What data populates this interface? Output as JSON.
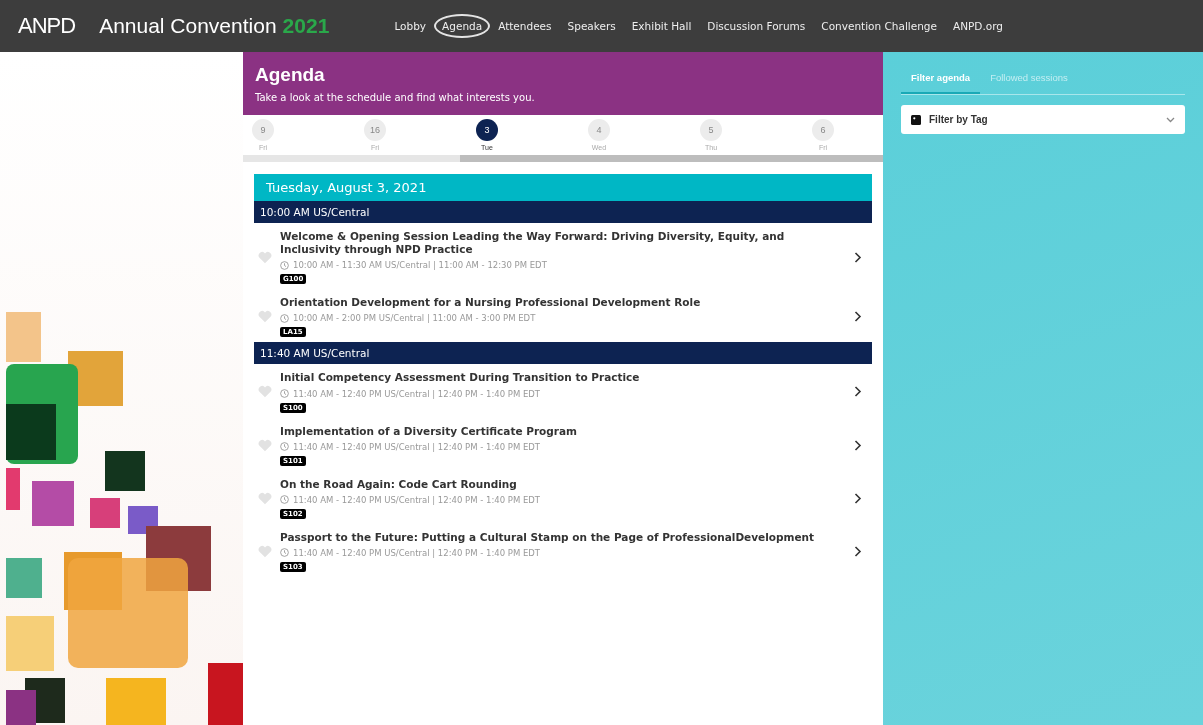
{
  "brand": {
    "logo": "ANPD",
    "title": "Annual Convention",
    "year": "2021"
  },
  "nav": [
    {
      "label": "Lobby",
      "selected": false
    },
    {
      "label": "Agenda",
      "selected": true
    },
    {
      "label": "Attendees",
      "selected": false
    },
    {
      "label": "Speakers",
      "selected": false
    },
    {
      "label": "Exhibit Hall",
      "selected": false
    },
    {
      "label": "Discussion Forums",
      "selected": false
    },
    {
      "label": "Convention Challenge",
      "selected": false
    },
    {
      "label": "ANPD.org",
      "selected": false
    }
  ],
  "header": {
    "title": "Agenda",
    "subtitle": "Take a look at the schedule and find what interests you."
  },
  "days": [
    {
      "number": "9",
      "weekday": "Fri",
      "selected": false
    },
    {
      "number": "16",
      "weekday": "Fri",
      "selected": false
    },
    {
      "number": "3",
      "weekday": "Tue",
      "selected": true
    },
    {
      "number": "4",
      "weekday": "Wed",
      "selected": false
    },
    {
      "number": "5",
      "weekday": "Thu",
      "selected": false
    },
    {
      "number": "6",
      "weekday": "Fri",
      "selected": false
    }
  ],
  "date_heading": "Tuesday, August 3, 2021",
  "time_groups": [
    {
      "time": "10:00 AM US/Central",
      "sessions": [
        {
          "title": "Welcome & Opening Session Leading the Way Forward: Driving Diversity, Equity, and Inclusivity through NPD Practice",
          "time": "10:00 AM - 11:30 AM US/Central | 11:00 AM - 12:30 PM EDT",
          "code": "G100",
          "followed": false
        },
        {
          "title": "Orientation Development for a Nursing Professional Development Role",
          "time": "10:00 AM - 2:00 PM US/Central | 11:00 AM - 3:00 PM EDT",
          "code": "LA15",
          "followed": false
        }
      ]
    },
    {
      "time": "11:40 AM US/Central",
      "sessions": [
        {
          "title": "Initial Competency Assessment During Transition to Practice",
          "time": "11:40 AM - 12:40 PM US/Central | 12:40 PM - 1:40 PM EDT",
          "code": "S100",
          "followed": false
        },
        {
          "title": "Implementation of a Diversity Certificate Program",
          "time": "11:40 AM - 12:40 PM US/Central | 12:40 PM - 1:40 PM EDT",
          "code": "S101",
          "followed": false
        },
        {
          "title": "On the Road Again: Code Cart Rounding",
          "time": "11:40 AM - 12:40 PM US/Central | 12:40 PM - 1:40 PM EDT",
          "code": "S102",
          "followed": false
        },
        {
          "title": "Passport to the Future: Putting a Cultural Stamp on the Page of ProfessionalDevelopment",
          "time": "11:40 AM - 12:40 PM US/Central | 12:40 PM - 1:40 PM EDT",
          "code": "S103",
          "followed": false
        }
      ]
    }
  ],
  "side_tabs": [
    {
      "label": "Filter agenda",
      "selected": true
    },
    {
      "label": "Followed sessions",
      "selected": false
    }
  ],
  "filter": {
    "label": "Filter by Tag"
  }
}
